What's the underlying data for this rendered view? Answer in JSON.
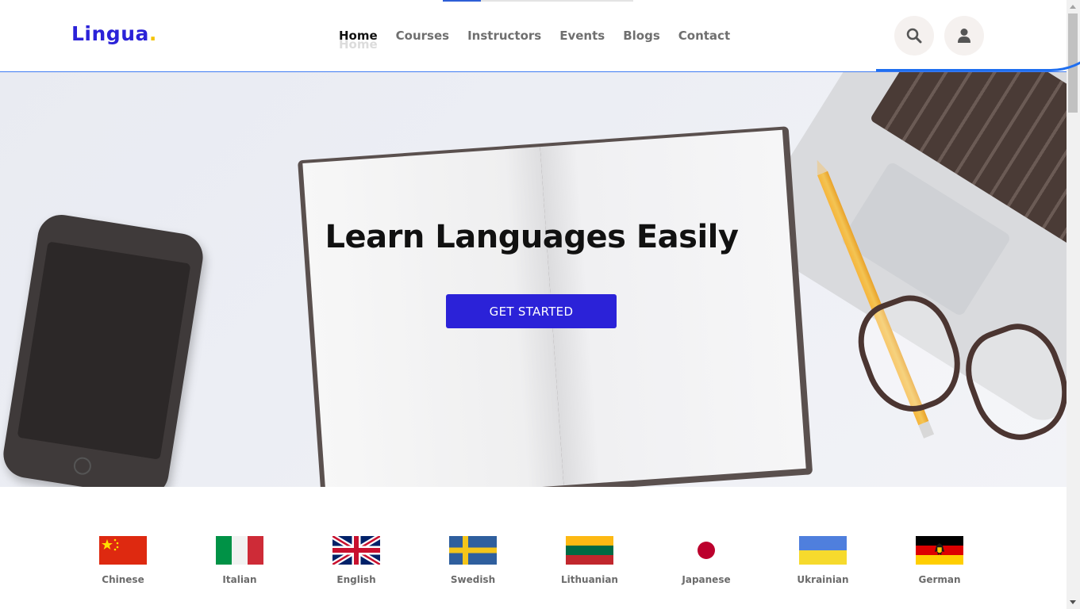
{
  "brand": {
    "name": "Lingua",
    "dot": ".",
    "color": "#2b22d8",
    "dot_color": "#f4c300"
  },
  "nav": {
    "items": [
      {
        "label": "Home",
        "active": true
      },
      {
        "label": "Courses",
        "active": false
      },
      {
        "label": "Instructors",
        "active": false
      },
      {
        "label": "Events",
        "active": false
      },
      {
        "label": "Blogs",
        "active": false
      },
      {
        "label": "Contact",
        "active": false
      }
    ],
    "ghost_label": "Home"
  },
  "header_actions": {
    "search_icon": "search-icon",
    "user_icon": "user-icon"
  },
  "hero": {
    "title": "Learn Languages Easily",
    "cta_label": "GET STARTED",
    "cta_color": "#2b22d8"
  },
  "languages": [
    {
      "name": "Chinese",
      "flag": "flag-china-icon"
    },
    {
      "name": "Italian",
      "flag": "flag-italy-icon"
    },
    {
      "name": "English",
      "flag": "flag-uk-icon"
    },
    {
      "name": "Swedish",
      "flag": "flag-sweden-icon"
    },
    {
      "name": "Lithuanian",
      "flag": "flag-lithuania-icon"
    },
    {
      "name": "Japanese",
      "flag": "flag-japan-icon"
    },
    {
      "name": "Ukrainian",
      "flag": "flag-ukraine-icon"
    },
    {
      "name": "German",
      "flag": "flag-germany-icon"
    }
  ]
}
